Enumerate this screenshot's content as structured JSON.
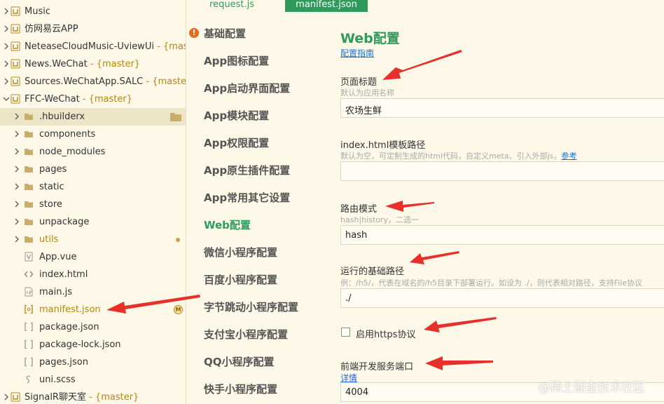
{
  "tree": {
    "items": [
      {
        "name": "Music"
      },
      {
        "name": "仿网易云APP"
      },
      {
        "name": "NeteaseCloudMusic-UviewUi",
        "branch": " - {master}"
      },
      {
        "name": "News.WeChat",
        "branch": " - {master}"
      },
      {
        "name": "Sources.WeChatApp.SALC",
        "branch": " - {master}"
      },
      {
        "name": "FFC-WeChat",
        "branch": " - {master}"
      },
      {
        "name": ".hbuilderx"
      },
      {
        "name": "components"
      },
      {
        "name": "node_modules"
      },
      {
        "name": "pages"
      },
      {
        "name": "static"
      },
      {
        "name": "store"
      },
      {
        "name": "unpackage"
      },
      {
        "name": "utils"
      },
      {
        "name": "App.vue"
      },
      {
        "name": "index.html"
      },
      {
        "name": "main.js"
      },
      {
        "name": "manifest.json",
        "status": "M"
      },
      {
        "name": "package.json"
      },
      {
        "name": "package-lock.json"
      },
      {
        "name": "pages.json"
      },
      {
        "name": "uni.scss"
      },
      {
        "name": "SignalR聊天室",
        "branch": " - {master}"
      }
    ]
  },
  "tabs": [
    {
      "label": "request.js"
    },
    {
      "label": "manifest.json"
    }
  ],
  "nav": {
    "items": [
      "基础配置",
      "App图标配置",
      "App启动界面配置",
      "App模块配置",
      "App权限配置",
      "App原生插件配置",
      "App常用其它设置",
      "Web配置",
      "微信小程序配置",
      "百度小程序配置",
      "字节跳动小程序配置",
      "支付宝小程序配置",
      "QQ小程序配置",
      "快手小程序配置"
    ],
    "warn_icon": "!"
  },
  "form": {
    "title": "Web配置",
    "guide_link": "配置指南",
    "page_title": {
      "label": "页面标题",
      "hint": "默认为应用名称",
      "value": "农场生鲜"
    },
    "template": {
      "label": "index.html模板路径",
      "hint": "默认为空，可定制生成的html代码，自定义meta、引入外部js，",
      "hint_link": "参考",
      "value": ""
    },
    "router": {
      "label": "路由模式",
      "hint": "hash|history，二选一",
      "value": "hash"
    },
    "base": {
      "label": "运行的基础路径",
      "hint": "例：/h5/，代表在域名的/h5目录下部署运行。如设为 ./，则代表相对路径，支持File协议",
      "value": "./"
    },
    "https": {
      "label": "启用https协议"
    },
    "port": {
      "label": "前端开发服务端口",
      "link": "详情",
      "value": "4004"
    }
  },
  "watermark": "@稀土掘金技术社区",
  "colors": {
    "accent": "#2e9b5d",
    "arrow": "#e8302a",
    "link": "#1e6fd0",
    "background": "#fdf8e8"
  }
}
